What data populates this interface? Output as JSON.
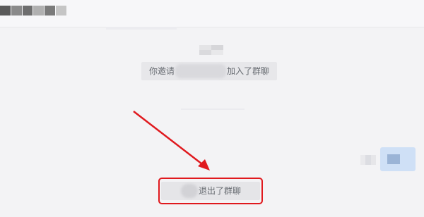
{
  "header": {
    "title_mosaic_colors": [
      "#5a5a5a",
      "#8a8a8a",
      "#6e6e6e",
      "#b0b0b0",
      "#7a7a7a",
      "#c5c5c5"
    ]
  },
  "messages": {
    "time_mosaic_colors": [
      "#e4e4e6",
      "#d6d6d9",
      "#dadadd",
      "#e8e8ea"
    ],
    "invite_notice": {
      "prefix": "你邀请",
      "suffix": "加入了群聊"
    },
    "outgoing_bubble": {
      "avatar_mosaic_colors": [
        "#e9e9ec",
        "#dcdde2",
        "#e6e6e9"
      ]
    },
    "exit_notice": {
      "text": "退出了群聊"
    }
  },
  "annotation": {
    "color": "#e0191e"
  }
}
